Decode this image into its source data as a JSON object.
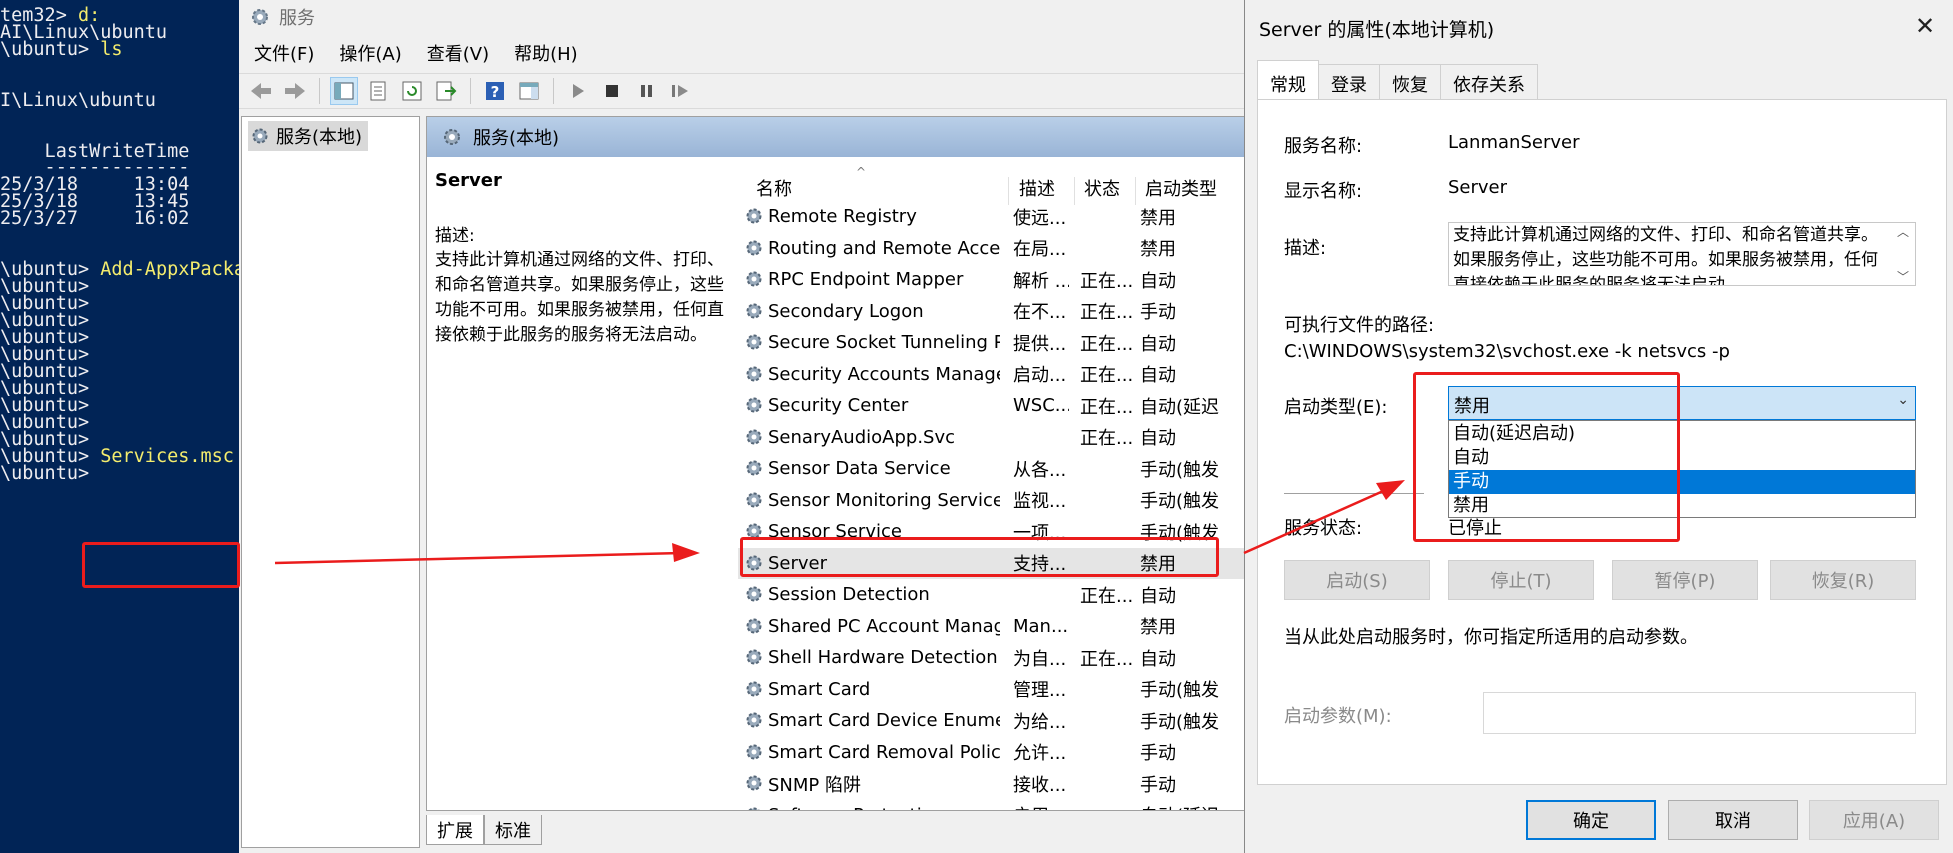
{
  "console": {
    "lines": [
      "tem32> d:",
      "AI\\Linux\\ubuntu",
      "\\ubuntu> ls",
      "",
      "",
      "I\\Linux\\ubuntu",
      "",
      "",
      "    LastWriteTime",
      "    -------------",
      "25/3/18     13:04",
      "25/3/18     13:45",
      "25/3/27     16:02",
      "",
      "",
      "\\ubuntu> Add-AppxPacka",
      "\\ubuntu>",
      "\\ubuntu>",
      "\\ubuntu>",
      "\\ubuntu>",
      "\\ubuntu>",
      "\\ubuntu>",
      "\\ubuntu>",
      "\\ubuntu>",
      "\\ubuntu>",
      "\\ubuntu>",
      "\\ubuntu>",
      "\\ubuntu>"
    ],
    "ls_command": "ls",
    "drive_command": "d:",
    "add_command": "Add-AppxPacka",
    "services_command": "Services.msc"
  },
  "mmc": {
    "title": "服务",
    "menu": [
      "文件(F)",
      "操作(A)",
      "查看(V)",
      "帮助(H)"
    ],
    "tree_node": "服务(本地)",
    "pane_header": "服务(本地)",
    "selected_service": "Server",
    "desc_label": "描述:",
    "desc_text": "支持此计算机通过网络的文件、打印、和命名管道共享。如果服务停止，这些功能不可用。如果服务被禁用，任何直接依赖于此服务的服务将无法启动。",
    "columns": [
      "名称",
      "描述",
      "状态",
      "启动类型"
    ],
    "rows": [
      {
        "name": "Remote Registry",
        "desc": "使远...",
        "status": "",
        "startup": "禁用"
      },
      {
        "name": "Routing and Remote Access",
        "desc": "在局...",
        "status": "",
        "startup": "禁用"
      },
      {
        "name": "RPC Endpoint Mapper",
        "desc": "解析 ...",
        "status": "正在...",
        "startup": "自动"
      },
      {
        "name": "Secondary Logon",
        "desc": "在不...",
        "status": "正在...",
        "startup": "手动"
      },
      {
        "name": "Secure Socket Tunneling P...",
        "desc": "提供...",
        "status": "正在...",
        "startup": "自动"
      },
      {
        "name": "Security Accounts Manager",
        "desc": "启动...",
        "status": "正在...",
        "startup": "自动"
      },
      {
        "name": "Security Center",
        "desc": "WSC...",
        "status": "正在...",
        "startup": "自动(延迟"
      },
      {
        "name": "SenaryAudioApp.Svc",
        "desc": "",
        "status": "正在...",
        "startup": "自动"
      },
      {
        "name": "Sensor Data Service",
        "desc": "从各...",
        "status": "",
        "startup": "手动(触发"
      },
      {
        "name": "Sensor Monitoring Service",
        "desc": "监视...",
        "status": "",
        "startup": "手动(触发"
      },
      {
        "name": "Sensor Service",
        "desc": "一项...",
        "status": "",
        "startup": "手动(触发"
      },
      {
        "name": "Server",
        "desc": "支持...",
        "status": "",
        "startup": "禁用"
      },
      {
        "name": "Session Detection",
        "desc": "",
        "status": "正在...",
        "startup": "自动"
      },
      {
        "name": "Shared PC Account Manager",
        "desc": "Man...",
        "status": "",
        "startup": "禁用"
      },
      {
        "name": "Shell Hardware Detection",
        "desc": "为自...",
        "status": "正在...",
        "startup": "自动"
      },
      {
        "name": "Smart Card",
        "desc": "管理...",
        "status": "",
        "startup": "手动(触发"
      },
      {
        "name": "Smart Card Device Enumer...",
        "desc": "为给...",
        "status": "",
        "startup": "手动(触发"
      },
      {
        "name": "Smart Card Removal Policy",
        "desc": "允许...",
        "status": "",
        "startup": "手动"
      },
      {
        "name": "SNMP 陷阱",
        "desc": "接收...",
        "status": "",
        "startup": "手动"
      },
      {
        "name": "Software Protection",
        "desc": "启用...",
        "status": "",
        "startup": "自动(延迟"
      }
    ],
    "tab_extended": "扩展",
    "tab_standard": "标准"
  },
  "dialog": {
    "title": "Server 的属性(本地计算机)",
    "tabs": [
      "常规",
      "登录",
      "恢复",
      "依存关系"
    ],
    "service_name_label": "服务名称:",
    "service_name": "LanmanServer",
    "display_name_label": "显示名称:",
    "display_name": "Server",
    "desc_label": "描述:",
    "desc_text": "支持此计算机通过网络的文件、打印、和命名管道共享。如果服务停止，这些功能不可用。如果服务被禁用，任何直接依赖于此服务的服务将无法启动。",
    "path_label": "可执行文件的路径:",
    "path": "C:\\WINDOWS\\system32\\svchost.exe -k netsvcs -p",
    "startup_label": "启动类型(E):",
    "startup_value": "禁用",
    "startup_options": [
      "自动(延迟启动)",
      "自动",
      "手动",
      "禁用"
    ],
    "highlighted_option": "手动",
    "status_label": "服务状态:",
    "status_value": "已停止",
    "btn_start": "启动(S)",
    "btn_stop": "停止(T)",
    "btn_pause": "暂停(P)",
    "btn_resume": "恢复(R)",
    "hint": "当从此处启动服务时，你可指定所适用的启动参数。",
    "param_label": "启动参数(M):",
    "btn_ok": "确定",
    "btn_cancel": "取消",
    "btn_apply": "应用(A)"
  },
  "colors": {
    "console_bg": "#012456",
    "console_text": "#eeedf0",
    "console_command": "#f4ec6d",
    "annotation_red": "#ea1c1c",
    "selection_blue": "#0078d7"
  }
}
